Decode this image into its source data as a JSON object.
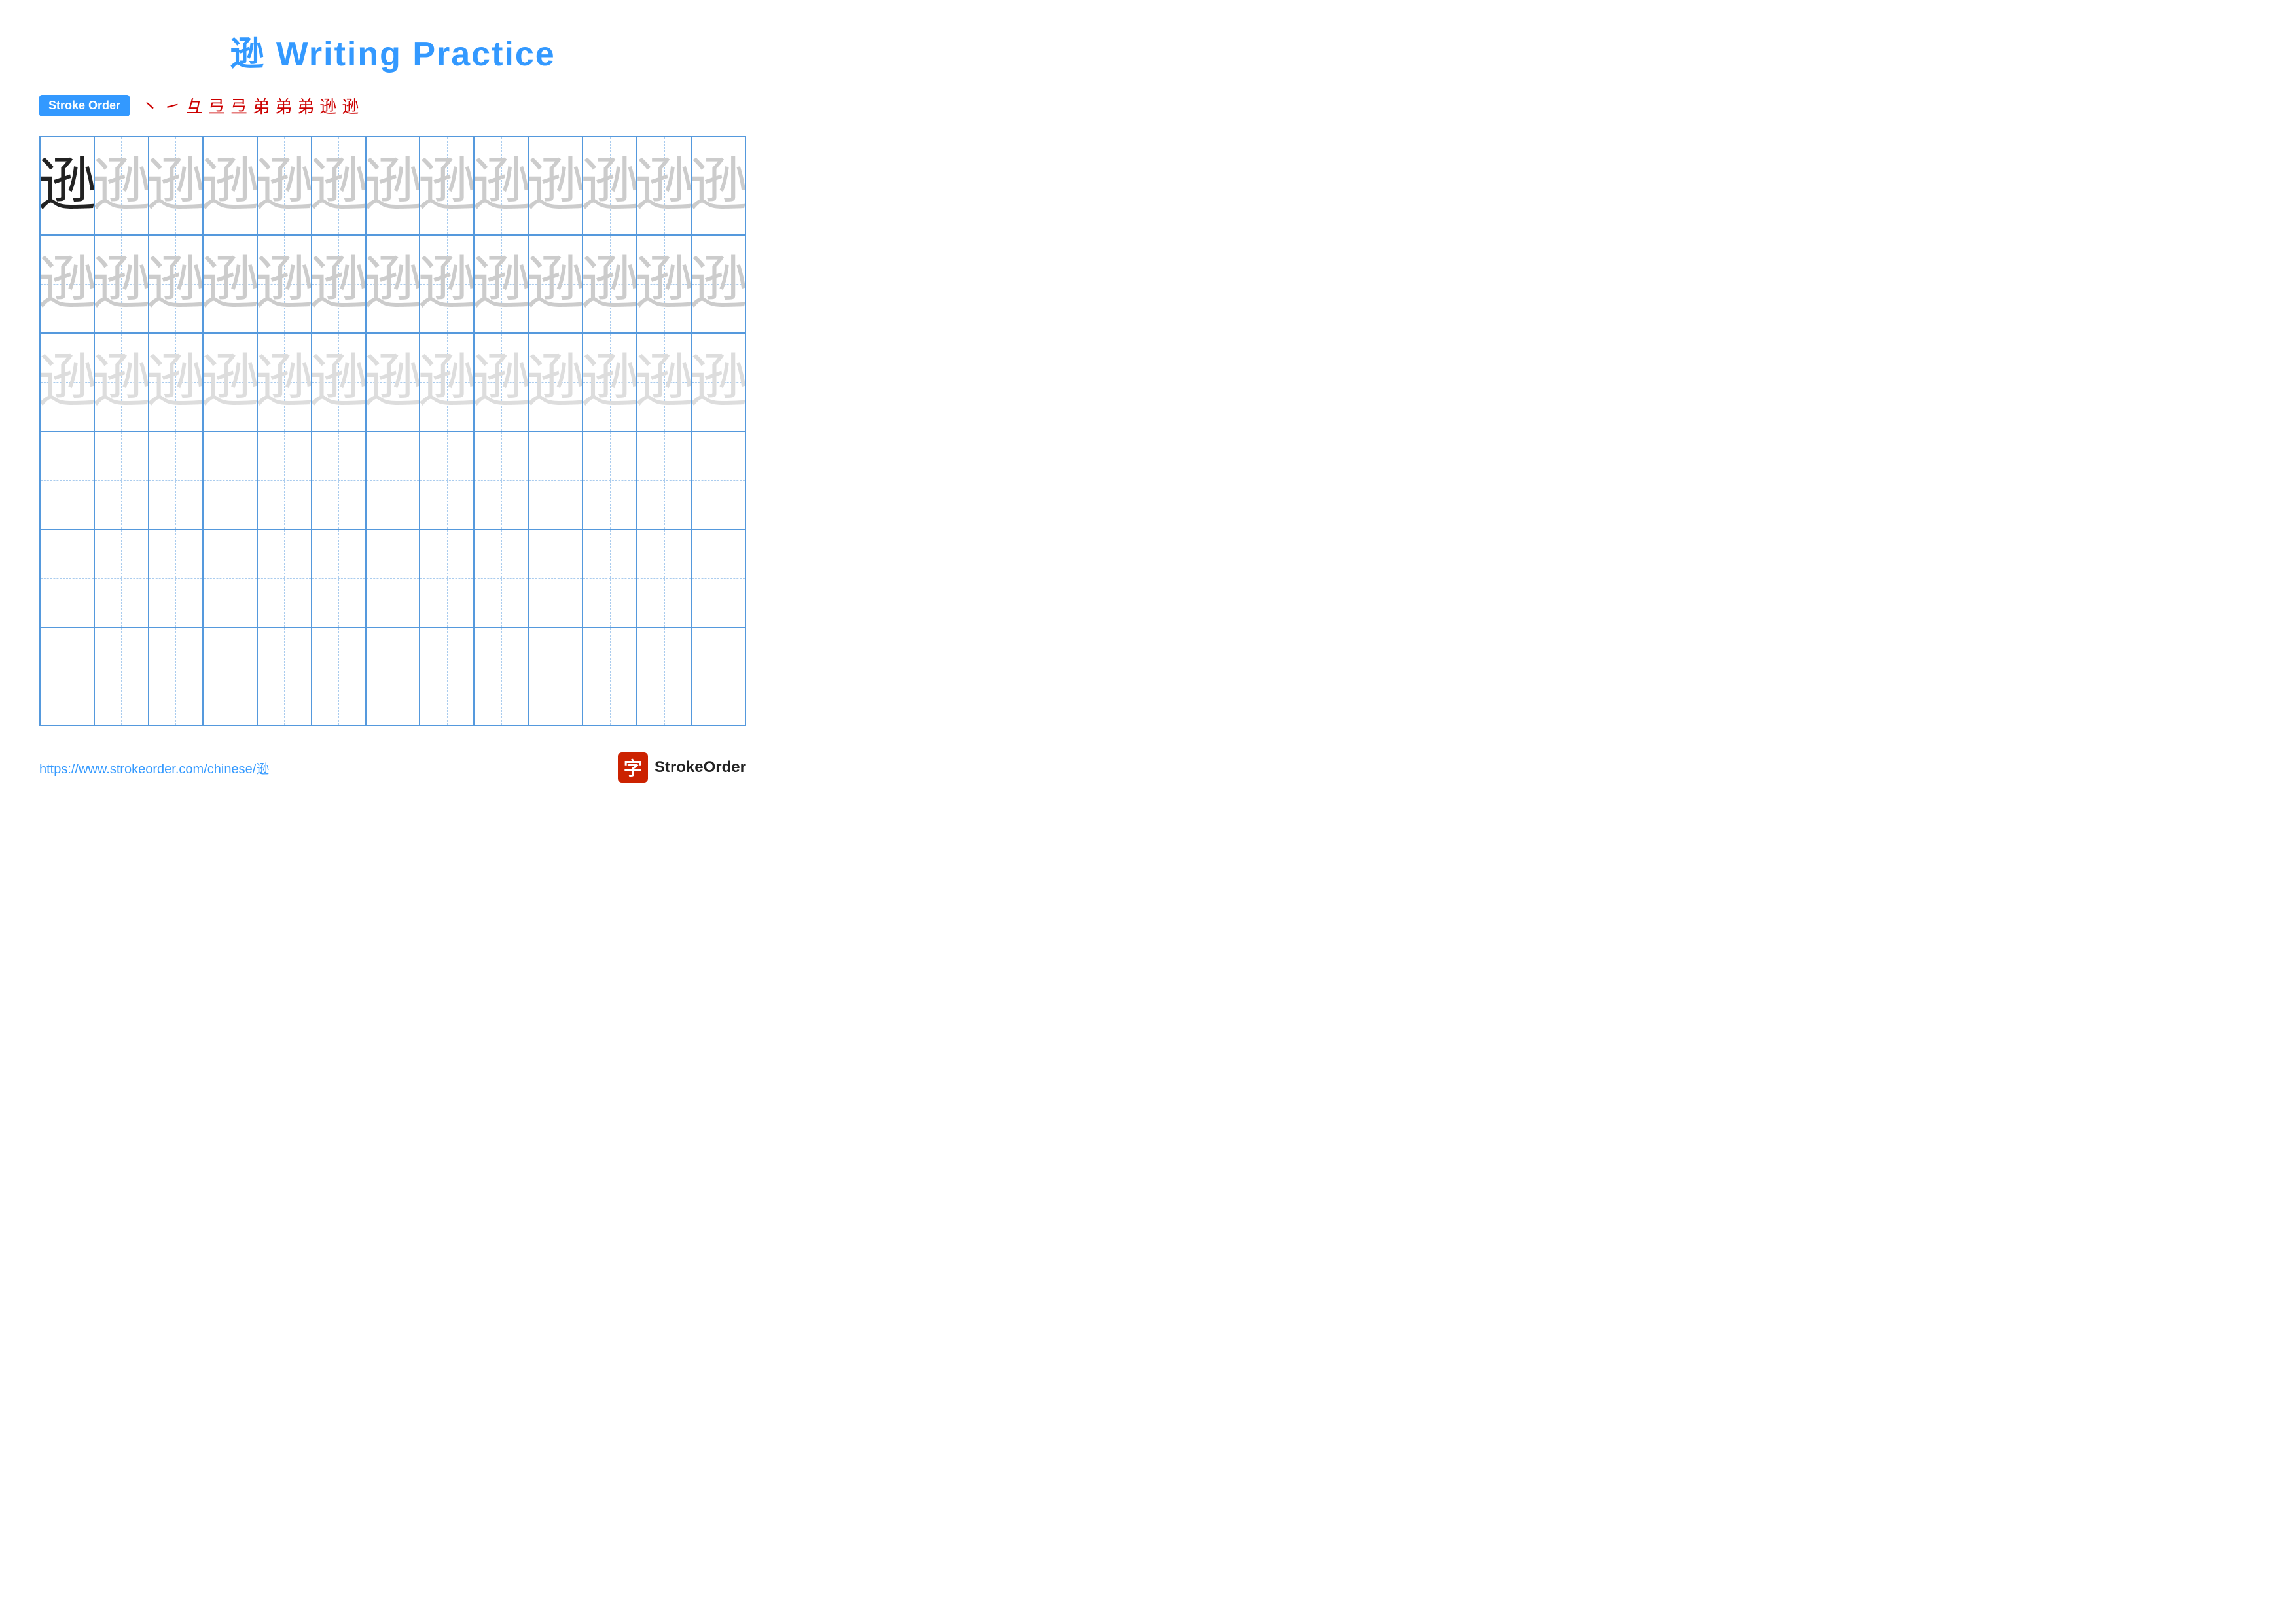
{
  "title": "逊 Writing Practice",
  "stroke_order": {
    "label": "Stroke Order",
    "strokes": [
      "丶",
      "㇀",
      "彑",
      "弖",
      "弖",
      "弟",
      "弟",
      "弟",
      "逊",
      "逊"
    ]
  },
  "character": "逊",
  "grid": {
    "rows": 6,
    "cols": 13,
    "row_types": [
      "solid_then_faint",
      "faint",
      "faint",
      "empty",
      "empty",
      "empty"
    ]
  },
  "footer": {
    "url": "https://www.strokeorder.com/chinese/逊",
    "brand": "StrokeOrder",
    "brand_char": "字"
  }
}
